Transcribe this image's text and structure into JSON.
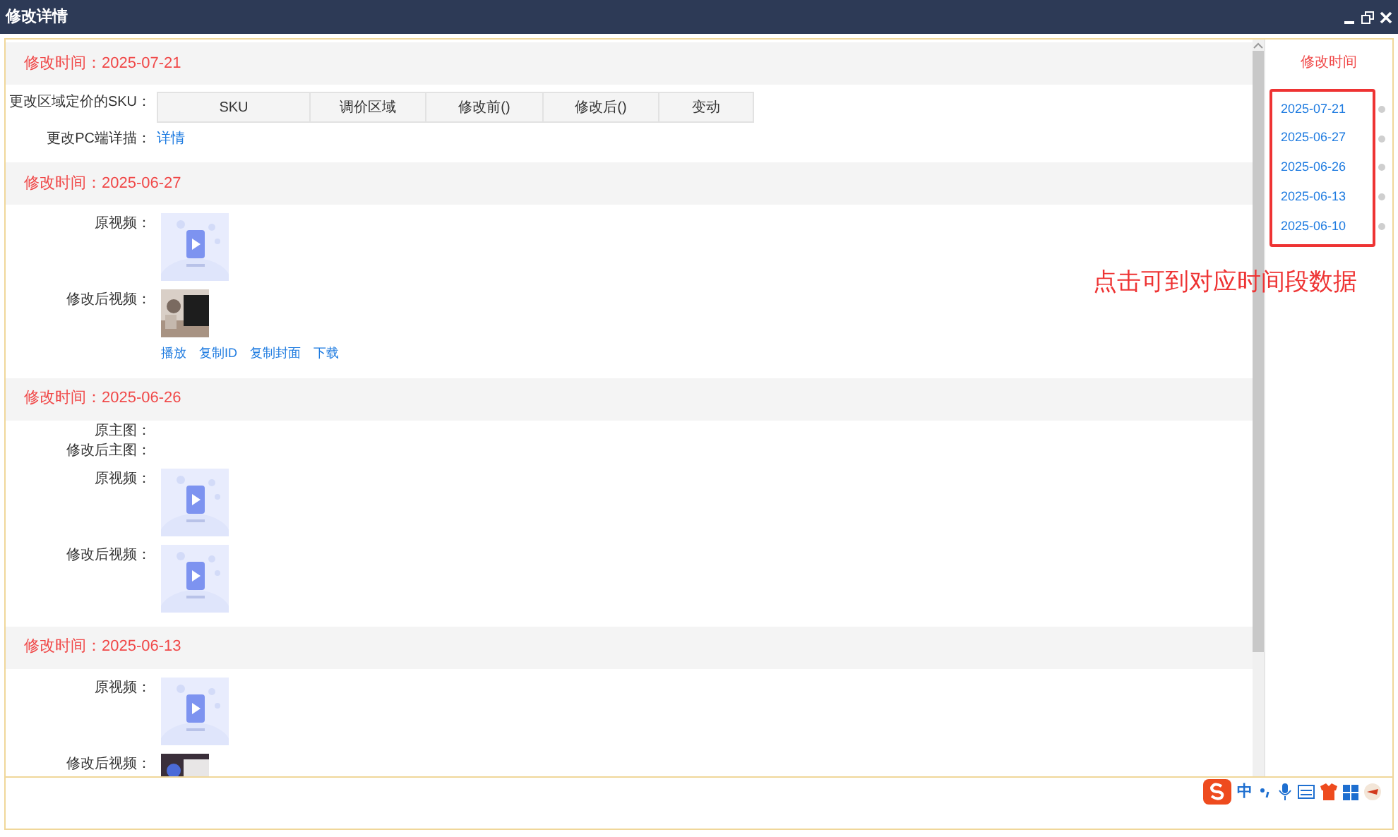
{
  "window": {
    "title": "修改详情"
  },
  "sections": [
    {
      "heading": "修改时间：2025-07-21",
      "rows": [
        {
          "kind": "table",
          "label": "更改区域定价的SKU：",
          "columns": [
            "SKU",
            "调价区域",
            "修改前()",
            "修改后()",
            "变动"
          ]
        },
        {
          "kind": "link",
          "label": "更改PC端详描：",
          "link": "详情"
        }
      ]
    },
    {
      "heading": "修改时间：2025-06-27",
      "rows": [
        {
          "kind": "video",
          "label": "原视频：",
          "thumbnail": {
            "kind": "placeholder"
          }
        },
        {
          "kind": "video",
          "label": "修改后视频：",
          "thumbnail": {
            "kind": "picture"
          },
          "actions": [
            "播放",
            "复制ID",
            "复制封面",
            "下载"
          ]
        }
      ]
    },
    {
      "heading": "修改时间：2025-06-26",
      "rows": [
        {
          "kind": "empty",
          "label": "原主图："
        },
        {
          "kind": "empty",
          "label": "修改后主图："
        },
        {
          "kind": "video",
          "label": "原视频：",
          "thumbnail": {
            "kind": "placeholder"
          }
        },
        {
          "kind": "video",
          "label": "修改后视频：",
          "thumbnail": {
            "kind": "placeholder"
          }
        }
      ]
    },
    {
      "heading": "修改时间：2025-06-13",
      "rows": [
        {
          "kind": "video",
          "label": "原视频：",
          "thumbnail": {
            "kind": "placeholder"
          }
        },
        {
          "kind": "video",
          "label": "修改后视频：",
          "thumbnail": {
            "kind": "picture"
          }
        }
      ]
    }
  ],
  "nav": {
    "title": "修改时间",
    "dates": [
      "2025-07-21",
      "2025-06-27",
      "2025-06-26",
      "2025-06-13",
      "2025-06-10"
    ]
  },
  "annotation": "点击可到对应时间段数据",
  "ime": {
    "mode": "中"
  }
}
